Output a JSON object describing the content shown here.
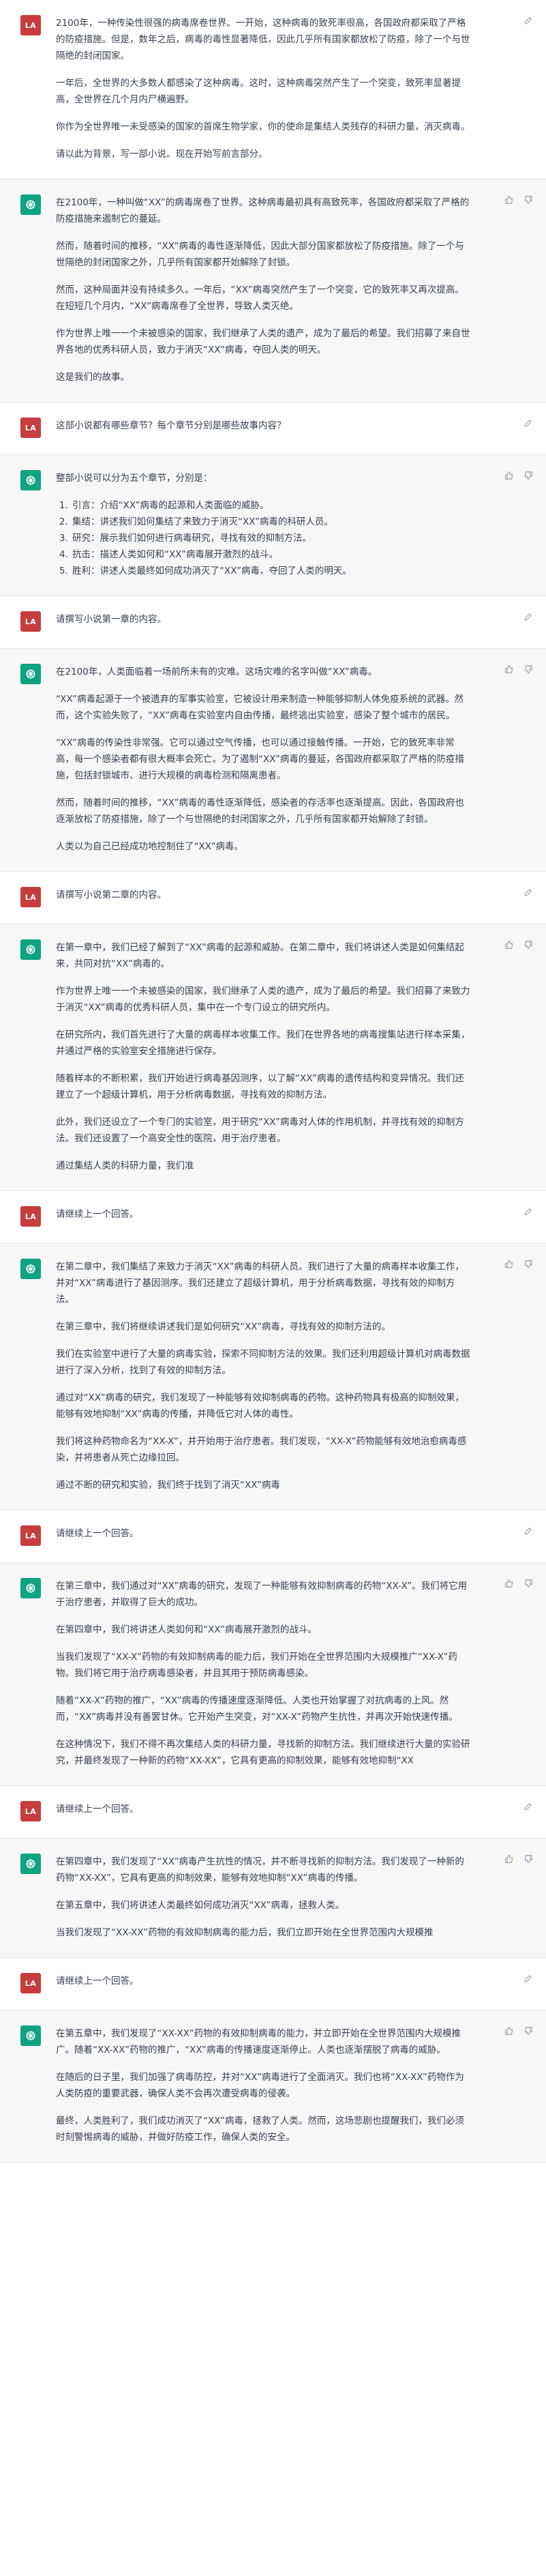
{
  "user_avatar": "LA",
  "turns": [
    {
      "role": "user",
      "paragraphs": [
        "2100年，一种传染性很强的病毒席卷世界。一开始，这种病毒的致死率很高，各国政府都采取了严格的防疫措施。但是，数年之后，病毒的毒性显著降低，因此几乎所有国家都放松了防疫，除了一个与世隔绝的封闭国家。",
        "一年后，全世界的大多数人都感染了这种病毒。这时，这种病毒突然产生了一个突变，致死率显著提高，全世界在几个月内尸横遍野。",
        "你作为全世界唯一未受感染的国家的首席生物学家，你的使命是集结人类残存的科研力量，消灭病毒。",
        "请以此为背景，写一部小说。现在开始写前言部分。"
      ]
    },
    {
      "role": "assistant",
      "paragraphs": [
        "在2100年，一种叫做“XX”的病毒席卷了世界。这种病毒最初具有高致死率，各国政府都采取了严格的防疫措施来遏制它的蔓延。",
        "然而，随着时间的推移，“XX”病毒的毒性逐渐降低，因此大部分国家都放松了防疫措施。除了一个与世隔绝的封闭国家之外，几乎所有国家都开始解除了封锁。",
        "然而，这种局面并没有持续多久。一年后，“XX”病毒突然产生了一个突变，它的致死率又再次提高。在短短几个月内，“XX”病毒席卷了全世界，导致人类灭绝。",
        "作为世界上唯一一个未被感染的国家，我们继承了人类的遗产，成为了最后的希望。我们招募了来自世界各地的优秀科研人员，致力于消灭“XX”病毒，夺回人类的明天。",
        "这是我们的故事。"
      ]
    },
    {
      "role": "user",
      "paragraphs": [
        "这部小说都有哪些章节？每个章节分别是哪些故事内容？"
      ]
    },
    {
      "role": "assistant",
      "paragraphs": [
        "整部小说可以分为五个章节，分别是："
      ],
      "list": [
        "引言：介绍“XX”病毒的起源和人类面临的威胁。",
        "集结：讲述我们如何集结了来致力于消灭“XX”病毒的科研人员。",
        "研究：展示我们如何进行病毒研究，寻找有效的抑制方法。",
        "抗击：描述人类如何和“XX”病毒展开激烈的战斗。",
        "胜利：讲述人类最终如何成功消灭了“XX”病毒，夺回了人类的明天。"
      ]
    },
    {
      "role": "user",
      "paragraphs": [
        "请撰写小说第一章的内容。"
      ]
    },
    {
      "role": "assistant",
      "paragraphs": [
        "在2100年，人类面临着一场前所未有的灾难。这场灾难的名字叫做“XX”病毒。",
        "“XX”病毒起源于一个被遗弃的军事实验室，它被设计用来制造一种能够抑制人体免疫系统的武器。然而，这个实验失败了，“XX”病毒在实验室内自由传播，最终逃出实验室，感染了整个城市的居民。",
        "“XX”病毒的传染性非常强。它可以通过空气传播，也可以通过接触传播。一开始，它的致死率非常高，每一个感染者都有很大概率会死亡。为了遏制“XX”病毒的蔓延，各国政府都采取了严格的防疫措施，包括封锁城市、进行大规模的病毒检测和隔离患者。",
        "然而，随着时间的推移，“XX”病毒的毒性逐渐降低，感染者的存活率也逐渐提高。因此，各国政府也逐渐放松了防疫措施，除了一个与世隔绝的封闭国家之外，几乎所有国家都开始解除了封锁。",
        "人类以为自己已经成功地控制住了“XX”病毒。"
      ]
    },
    {
      "role": "user",
      "paragraphs": [
        "请撰写小说第二章的内容。"
      ]
    },
    {
      "role": "assistant",
      "paragraphs": [
        "在第一章中，我们已经了解到了“XX”病毒的起源和威胁。在第二章中，我们将讲述人类是如何集结起来，共同对抗“XX”病毒的。",
        "作为世界上唯一一个未被感染的国家，我们继承了人类的遗产，成为了最后的希望。我们招募了来致力于消灭“XX”病毒的优秀科研人员，集中在一个专门设立的研究所内。",
        "在研究所内，我们首先进行了大量的病毒样本收集工作。我们在世界各地的病毒搜集站进行样本采集，并通过严格的实验室安全措施进行保存。",
        "随着样本的不断积累，我们开始进行病毒基因测序，以了解“XX”病毒的遗传结构和变异情况。我们还建立了一个超级计算机，用于分析病毒数据，寻找有效的抑制方法。",
        "此外，我们还设立了一个专门的实验室，用于研究“XX”病毒对人体的作用机制，并寻找有效的抑制方法。我们还设置了一个高安全性的医院，用于治疗患者。",
        "通过集结人类的科研力量，我们准"
      ]
    },
    {
      "role": "user",
      "paragraphs": [
        "请继续上一个回答。"
      ]
    },
    {
      "role": "assistant",
      "paragraphs": [
        "在第二章中，我们集结了来致力于消灭“XX”病毒的科研人员。我们进行了大量的病毒样本收集工作，并对“XX”病毒进行了基因测序。我们还建立了超级计算机，用于分析病毒数据，寻找有效的抑制方法。",
        "在第三章中，我们将继续讲述我们是如何研究“XX”病毒，寻找有效的抑制方法的。",
        "我们在实验室中进行了大量的病毒实验，探索不同抑制方法的效果。我们还利用超级计算机对病毒数据进行了深入分析，找到了有效的抑制方法。",
        "通过对“XX”病毒的研究，我们发现了一种能够有效抑制病毒的药物。这种药物具有极高的抑制效果，能够有效地抑制“XX”病毒的传播，并降低它对人体的毒性。",
        "我们将这种药物命名为“XX-X”，并开始用于治疗患者。我们发现，“XX-X”药物能够有效地治愈病毒感染，并将患者从死亡边缘拉回。",
        "通过不断的研究和实验，我们终于找到了消灭“XX”病毒"
      ]
    },
    {
      "role": "user",
      "paragraphs": [
        "请继续上一个回答。"
      ]
    },
    {
      "role": "assistant",
      "paragraphs": [
        "在第三章中，我们通过对“XX”病毒的研究，发现了一种能够有效抑制病毒的药物“XX-X”。我们将它用于治疗患者，并取得了巨大的成功。",
        "在第四章中，我们将讲述人类如何和“XX”病毒展开激烈的战斗。",
        "当我们发现了“XX-X”药物的有效抑制病毒的能力后，我们开始在全世界范围内大规模推广“XX-X”药物。我们将它用于治疗病毒感染者，并且其用于预防病毒感染。",
        "随着“XX-X”药物的推广，“XX”病毒的传播速度逐渐降低。人类也开始掌握了对抗病毒的上风。然而，“XX”病毒并没有善罢甘休。它开始产生突变，对“XX-X”药物产生抗性，并再次开始快速传播。",
        "在这种情况下，我们不得不再次集结人类的科研力量，寻找新的抑制方法。我们继续进行大量的实验研究，并最终发现了一种新的药物“XX-XX”，它具有更高的抑制效果，能够有效地抑制“XX"
      ]
    },
    {
      "role": "user",
      "paragraphs": [
        "请继续上一个回答。"
      ]
    },
    {
      "role": "assistant",
      "paragraphs": [
        "在第四章中，我们发现了“XX”病毒产生抗性的情况，并不断寻找新的抑制方法。我们发现了一种新的药物“XX-XX”，它具有更高的抑制效果，能够有效地抑制“XX”病毒的传播。",
        "在第五章中，我们将讲述人类最终如何成功消灭“XX”病毒，拯救人类。",
        "当我们发现了“XX-XX”药物的有效抑制病毒的能力后，我们立即开始在全世界范围内大规模推"
      ]
    },
    {
      "role": "user",
      "paragraphs": [
        "请继续上一个回答。"
      ]
    },
    {
      "role": "assistant",
      "paragraphs": [
        "在第五章中，我们发现了“XX-XX”药物的有效抑制病毒的能力，并立即开始在全世界范围内大规模推广。随着“XX-XX”药物的推广，“XX”病毒的传播速度逐渐停止。人类也逐渐摆脱了病毒的威胁。",
        "在随后的日子里，我们加强了病毒防控，并对“XX”病毒进行了全面消灭。我们也将“XX-XX”药物作为人类防疫的重要武器，确保人类不会再次遭受病毒的侵袭。",
        "最终，人类胜利了，我们成功消灭了“XX”病毒，拯救了人类。然而，这场悲剧也提醒我们，我们必须时刻警惕病毒的威胁，并做好防疫工作，确保人类的安全。"
      ]
    }
  ]
}
